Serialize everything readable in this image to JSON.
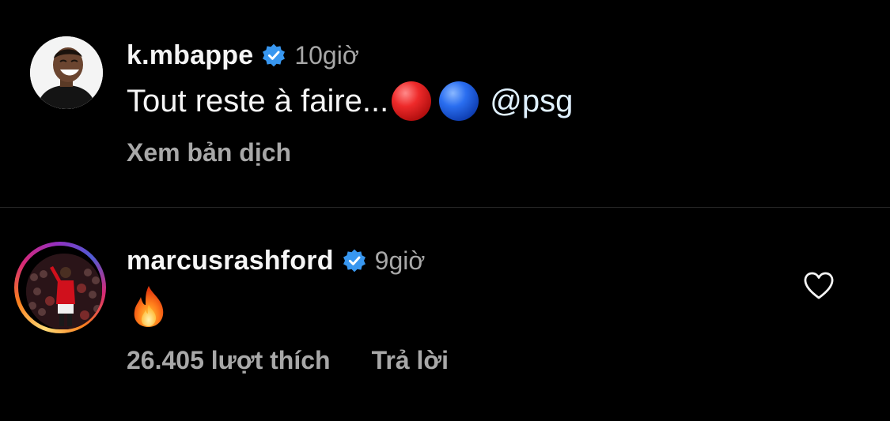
{
  "comments": [
    {
      "username": "k.mbappe",
      "verified": true,
      "time": "10giờ",
      "text": "Tout reste à faire...",
      "emojis": [
        "red-circle",
        "blue-circle"
      ],
      "mention": "@psg",
      "translate_label": "Xem bản dịch"
    },
    {
      "username": "marcusrashford",
      "verified": true,
      "time": "9giờ",
      "emoji": "fire",
      "likes_label": "26.405 lượt thích",
      "reply_label": "Trả lời",
      "has_story_ring": true
    }
  ],
  "colors": {
    "background": "#000000",
    "text_primary": "#f5f5f5",
    "text_secondary": "#a8a8a8",
    "verified_badge": "#3897f0",
    "divider": "#262626"
  },
  "icons": {
    "verified": "verified-badge-icon",
    "like": "heart-outline-icon"
  }
}
